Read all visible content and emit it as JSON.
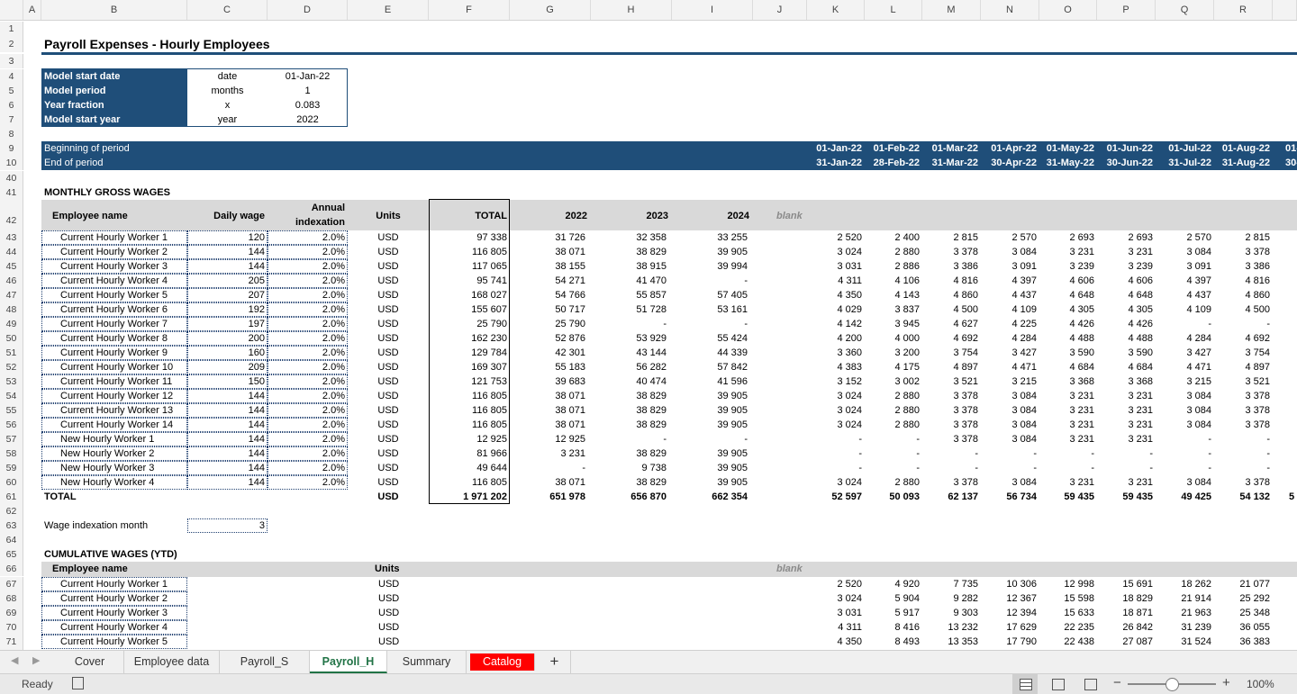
{
  "columns": [
    "A",
    "B",
    "C",
    "D",
    "E",
    "F",
    "G",
    "H",
    "I",
    "J",
    "K",
    "L",
    "M",
    "N",
    "O",
    "P",
    "Q",
    "R"
  ],
  "title": "Payroll Expenses - Hourly Employees",
  "params": [
    {
      "label": "Model start date",
      "unit": "date",
      "value": "01-Jan-22"
    },
    {
      "label": "Model period",
      "unit": "months",
      "value": "1"
    },
    {
      "label": "Year fraction",
      "unit": "x",
      "value": "0.083"
    },
    {
      "label": "Model start year",
      "unit": "year",
      "value": "2022"
    }
  ],
  "periods": {
    "begin_label": "Beginning of period",
    "end_label": "End of period",
    "begin": [
      "01-Jan-22",
      "01-Feb-22",
      "01-Mar-22",
      "01-Apr-22",
      "01-May-22",
      "01-Jun-22",
      "01-Jul-22",
      "01-Aug-22"
    ],
    "end": [
      "31-Jan-22",
      "28-Feb-22",
      "31-Mar-22",
      "30-Apr-22",
      "31-May-22",
      "30-Jun-22",
      "31-Jul-22",
      "31-Aug-22"
    ],
    "cut_begin": "01-",
    "cut_end": "30-"
  },
  "wages": {
    "section_title": "MONTHLY GROSS WAGES",
    "headers": {
      "name": "Employee name",
      "daily": "Daily wage",
      "index1": "Annual",
      "index2": "indexation",
      "units": "Units",
      "total": "TOTAL",
      "y2022": "2022",
      "y2023": "2023",
      "y2024": "2024",
      "blank": "blank"
    },
    "rows": [
      {
        "name": "Current Hourly Worker 1",
        "daily": "120",
        "idx": "2.0%",
        "units": "USD",
        "total": "97 338",
        "y": [
          "31 726",
          "32 358",
          "33 255"
        ],
        "m": [
          "2 520",
          "2 400",
          "2 815",
          "2 570",
          "2 693",
          "2 693",
          "2 570",
          "2 815"
        ]
      },
      {
        "name": "Current Hourly Worker 2",
        "daily": "144",
        "idx": "2.0%",
        "units": "USD",
        "total": "116 805",
        "y": [
          "38 071",
          "38 829",
          "39 905"
        ],
        "m": [
          "3 024",
          "2 880",
          "3 378",
          "3 084",
          "3 231",
          "3 231",
          "3 084",
          "3 378"
        ]
      },
      {
        "name": "Current Hourly Worker 3",
        "daily": "144",
        "idx": "2.0%",
        "units": "USD",
        "total": "117 065",
        "y": [
          "38 155",
          "38 915",
          "39 994"
        ],
        "m": [
          "3 031",
          "2 886",
          "3 386",
          "3 091",
          "3 239",
          "3 239",
          "3 091",
          "3 386"
        ]
      },
      {
        "name": "Current Hourly Worker 4",
        "daily": "205",
        "idx": "2.0%",
        "units": "USD",
        "total": "95 741",
        "y": [
          "54 271",
          "41 470",
          "-"
        ],
        "m": [
          "4 311",
          "4 106",
          "4 816",
          "4 397",
          "4 606",
          "4 606",
          "4 397",
          "4 816"
        ]
      },
      {
        "name": "Current Hourly Worker 5",
        "daily": "207",
        "idx": "2.0%",
        "units": "USD",
        "total": "168 027",
        "y": [
          "54 766",
          "55 857",
          "57 405"
        ],
        "m": [
          "4 350",
          "4 143",
          "4 860",
          "4 437",
          "4 648",
          "4 648",
          "4 437",
          "4 860"
        ]
      },
      {
        "name": "Current Hourly Worker 6",
        "daily": "192",
        "idx": "2.0%",
        "units": "USD",
        "total": "155 607",
        "y": [
          "50 717",
          "51 728",
          "53 161"
        ],
        "m": [
          "4 029",
          "3 837",
          "4 500",
          "4 109",
          "4 305",
          "4 305",
          "4 109",
          "4 500"
        ]
      },
      {
        "name": "Current Hourly Worker 7",
        "daily": "197",
        "idx": "2.0%",
        "units": "USD",
        "total": "25 790",
        "y": [
          "25 790",
          "-",
          "-"
        ],
        "m": [
          "4 142",
          "3 945",
          "4 627",
          "4 225",
          "4 426",
          "4 426",
          "-",
          "-"
        ]
      },
      {
        "name": "Current Hourly Worker 8",
        "daily": "200",
        "idx": "2.0%",
        "units": "USD",
        "total": "162 230",
        "y": [
          "52 876",
          "53 929",
          "55 424"
        ],
        "m": [
          "4 200",
          "4 000",
          "4 692",
          "4 284",
          "4 488",
          "4 488",
          "4 284",
          "4 692"
        ]
      },
      {
        "name": "Current Hourly Worker 9",
        "daily": "160",
        "idx": "2.0%",
        "units": "USD",
        "total": "129 784",
        "y": [
          "42 301",
          "43 144",
          "44 339"
        ],
        "m": [
          "3 360",
          "3 200",
          "3 754",
          "3 427",
          "3 590",
          "3 590",
          "3 427",
          "3 754"
        ]
      },
      {
        "name": "Current Hourly Worker 10",
        "daily": "209",
        "idx": "2.0%",
        "units": "USD",
        "total": "169 307",
        "y": [
          "55 183",
          "56 282",
          "57 842"
        ],
        "m": [
          "4 383",
          "4 175",
          "4 897",
          "4 471",
          "4 684",
          "4 684",
          "4 471",
          "4 897"
        ]
      },
      {
        "name": "Current Hourly Worker 11",
        "daily": "150",
        "idx": "2.0%",
        "units": "USD",
        "total": "121 753",
        "y": [
          "39 683",
          "40 474",
          "41 596"
        ],
        "m": [
          "3 152",
          "3 002",
          "3 521",
          "3 215",
          "3 368",
          "3 368",
          "3 215",
          "3 521"
        ]
      },
      {
        "name": "Current Hourly Worker 12",
        "daily": "144",
        "idx": "2.0%",
        "units": "USD",
        "total": "116 805",
        "y": [
          "38 071",
          "38 829",
          "39 905"
        ],
        "m": [
          "3 024",
          "2 880",
          "3 378",
          "3 084",
          "3 231",
          "3 231",
          "3 084",
          "3 378"
        ]
      },
      {
        "name": "Current Hourly Worker 13",
        "daily": "144",
        "idx": "2.0%",
        "units": "USD",
        "total": "116 805",
        "y": [
          "38 071",
          "38 829",
          "39 905"
        ],
        "m": [
          "3 024",
          "2 880",
          "3 378",
          "3 084",
          "3 231",
          "3 231",
          "3 084",
          "3 378"
        ]
      },
      {
        "name": "Current Hourly Worker 14",
        "daily": "144",
        "idx": "2.0%",
        "units": "USD",
        "total": "116 805",
        "y": [
          "38 071",
          "38 829",
          "39 905"
        ],
        "m": [
          "3 024",
          "2 880",
          "3 378",
          "3 084",
          "3 231",
          "3 231",
          "3 084",
          "3 378"
        ]
      },
      {
        "name": "New Hourly Worker 1",
        "daily": "144",
        "idx": "2.0%",
        "units": "USD",
        "total": "12 925",
        "y": [
          "12 925",
          "-",
          "-"
        ],
        "m": [
          "-",
          "-",
          "3 378",
          "3 084",
          "3 231",
          "3 231",
          "-",
          "-"
        ]
      },
      {
        "name": "New Hourly Worker 2",
        "daily": "144",
        "idx": "2.0%",
        "units": "USD",
        "total": "81 966",
        "y": [
          "3 231",
          "38 829",
          "39 905"
        ],
        "m": [
          "-",
          "-",
          "-",
          "-",
          "-",
          "-",
          "-",
          "-"
        ]
      },
      {
        "name": "New Hourly Worker 3",
        "daily": "144",
        "idx": "2.0%",
        "units": "USD",
        "total": "49 644",
        "y": [
          "-",
          "9 738",
          "39 905"
        ],
        "m": [
          "-",
          "-",
          "-",
          "-",
          "-",
          "-",
          "-",
          "-"
        ]
      },
      {
        "name": "New Hourly Worker 4",
        "daily": "144",
        "idx": "2.0%",
        "units": "USD",
        "total": "116 805",
        "y": [
          "38 071",
          "38 829",
          "39 905"
        ],
        "m": [
          "3 024",
          "2 880",
          "3 378",
          "3 084",
          "3 231",
          "3 231",
          "3 084",
          "3 378"
        ]
      }
    ],
    "total_row": {
      "name": "TOTAL",
      "units": "USD",
      "total": "1 971 202",
      "y": [
        "651 978",
        "656 870",
        "662 354"
      ],
      "m": [
        "52 597",
        "50 093",
        "62 137",
        "56 734",
        "59 435",
        "59 435",
        "49 425",
        "54 132"
      ]
    }
  },
  "indexation": {
    "label": "Wage indexation month",
    "value": "3"
  },
  "cumulative": {
    "section_title": "CUMULATIVE WAGES (YTD)",
    "headers": {
      "name": "Employee name",
      "units": "Units",
      "blank": "blank"
    },
    "rows": [
      {
        "name": "Current Hourly Worker 1",
        "units": "USD",
        "m": [
          "2 520",
          "4 920",
          "7 735",
          "10 306",
          "12 998",
          "15 691",
          "18 262",
          "21 077"
        ]
      },
      {
        "name": "Current Hourly Worker 2",
        "units": "USD",
        "m": [
          "3 024",
          "5 904",
          "9 282",
          "12 367",
          "15 598",
          "18 829",
          "21 914",
          "25 292"
        ]
      },
      {
        "name": "Current Hourly Worker 3",
        "units": "USD",
        "m": [
          "3 031",
          "5 917",
          "9 303",
          "12 394",
          "15 633",
          "18 871",
          "21 963",
          "25 348"
        ]
      },
      {
        "name": "Current Hourly Worker 4",
        "units": "USD",
        "m": [
          "4 311",
          "8 416",
          "13 232",
          "17 629",
          "22 235",
          "26 842",
          "31 239",
          "36 055"
        ]
      },
      {
        "name": "Current Hourly Worker 5",
        "units": "USD",
        "m": [
          "4 350",
          "8 493",
          "13 353",
          "17 790",
          "22 438",
          "27 087",
          "31 524",
          "36 383"
        ]
      }
    ]
  },
  "tabs": [
    "Cover",
    "Employee data",
    "Payroll_S",
    "Payroll_H",
    "Summary",
    "Catalog"
  ],
  "active_tab": "Payroll_H",
  "add_tab": "+",
  "status": {
    "ready": "Ready",
    "zoom": "100%"
  },
  "colors": {
    "band": "#1f4e79",
    "header_grey": "#d9d9d9",
    "active_tab": "#217346",
    "catalog_tab": "#ff0000"
  }
}
